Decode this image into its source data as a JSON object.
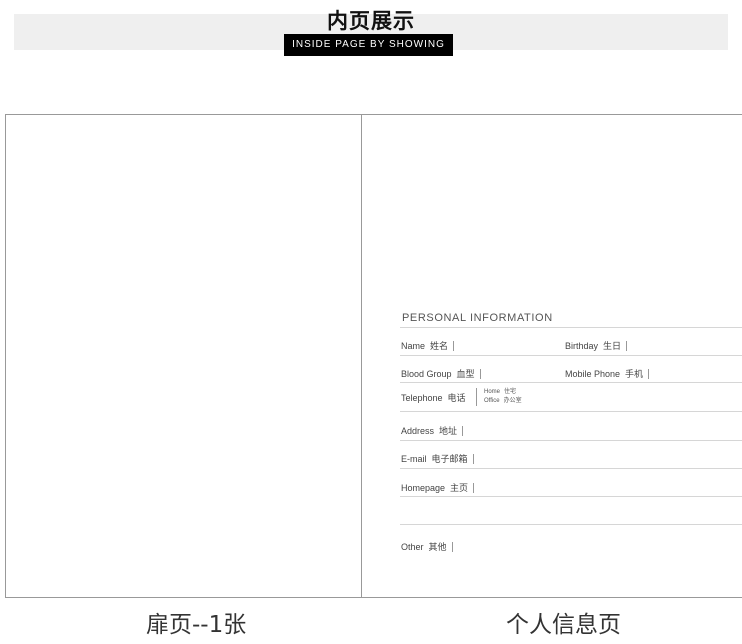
{
  "header": {
    "title": "内页展示",
    "subtitle": "INSIDE PAGE BY SHOWING"
  },
  "form": {
    "title": "PERSONAL  INFORMATION",
    "name": {
      "en": "Name",
      "cn": "姓名"
    },
    "birthday": {
      "en": "Birthday",
      "cn": "生日"
    },
    "blood_group": {
      "en": "Blood Group",
      "cn": "血型"
    },
    "mobile_phone": {
      "en": "Mobile Phone",
      "cn": "手机"
    },
    "telephone": {
      "en": "Telephone",
      "cn": "电话"
    },
    "home": {
      "en": "Home",
      "cn": "住宅"
    },
    "office": {
      "en": "Office",
      "cn": "办公室"
    },
    "address": {
      "en": "Address",
      "cn": "地址"
    },
    "email": {
      "en": "E-mail",
      "cn": "电子邮箱"
    },
    "homepage": {
      "en": "Homepage",
      "cn": "主页"
    },
    "other": {
      "en": "Other",
      "cn": "其他"
    }
  },
  "captions": {
    "left": "扉页--1张",
    "right": "个人信息页"
  }
}
